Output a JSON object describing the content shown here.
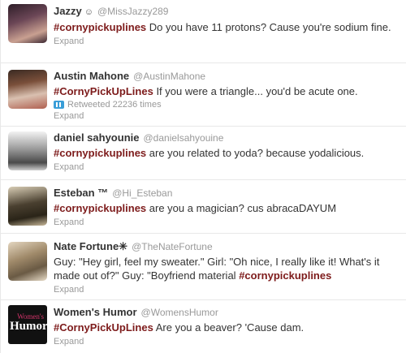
{
  "tweets": [
    {
      "name": "Jazzy",
      "badge": "☺",
      "handle": "@MissJazzy289",
      "hashtag": "#cornypickuplines",
      "text_before": "",
      "text_after": " Do you have 11 protons? Cause you're sodium fine.",
      "expand": "Expand",
      "avatar_colors": [
        "#5a3a4a",
        "#c9a091"
      ]
    },
    {
      "name": "Austin Mahone",
      "handle": "@AustinMahone",
      "hashtag": "#CornyPickUpLines",
      "text_before": "",
      "text_after": " If you were a triangle... you'd be acute one.",
      "retweet": "Retweeted 22236 times",
      "expand": "Expand",
      "avatar_colors": [
        "#7a4f3a",
        "#d9c0b0"
      ]
    },
    {
      "name": "daniel sahyounie",
      "handle": "@danielsahyouine",
      "hashtag": "#cornypickuplines",
      "text_before": "",
      "text_after": " are you related to yoda? because yodalicious.",
      "expand": "Expand",
      "avatar_colors": [
        "#8a8a8a",
        "#dcdcdc"
      ]
    },
    {
      "name": "Esteban ™",
      "handle": "@Hi_Esteban",
      "hashtag": "#cornypickuplines",
      "text_before": "",
      "text_after": " are you a magician? cus abracaDAYUM",
      "expand": "Expand",
      "avatar_colors": [
        "#4a4030",
        "#c8b89a"
      ]
    },
    {
      "name": "Nate Fortune✳",
      "handle": "@TheNateFortune",
      "hashtag": "#cornypickuplines",
      "text_before": "Guy: \"Hey girl, feel my sweater.\" Girl: \"Oh nice, I really like it! What's it made out of?\" Guy: \"Boyfriend material ",
      "text_after": "",
      "expand": "Expand",
      "avatar_colors": [
        "#a08a6a",
        "#e4d6c0"
      ]
    },
    {
      "name": "Women's Humor",
      "handle": "@WomensHumor",
      "hashtag": "#CornyPickUpLines",
      "text_before": "",
      "text_after": " Are you a beaver? 'Cause dam.",
      "expand": "Expand",
      "logo_top": "Women's",
      "logo_bottom": "Humor",
      "logo_bg": "#111111",
      "logo_accent": "#d4346a"
    }
  ]
}
